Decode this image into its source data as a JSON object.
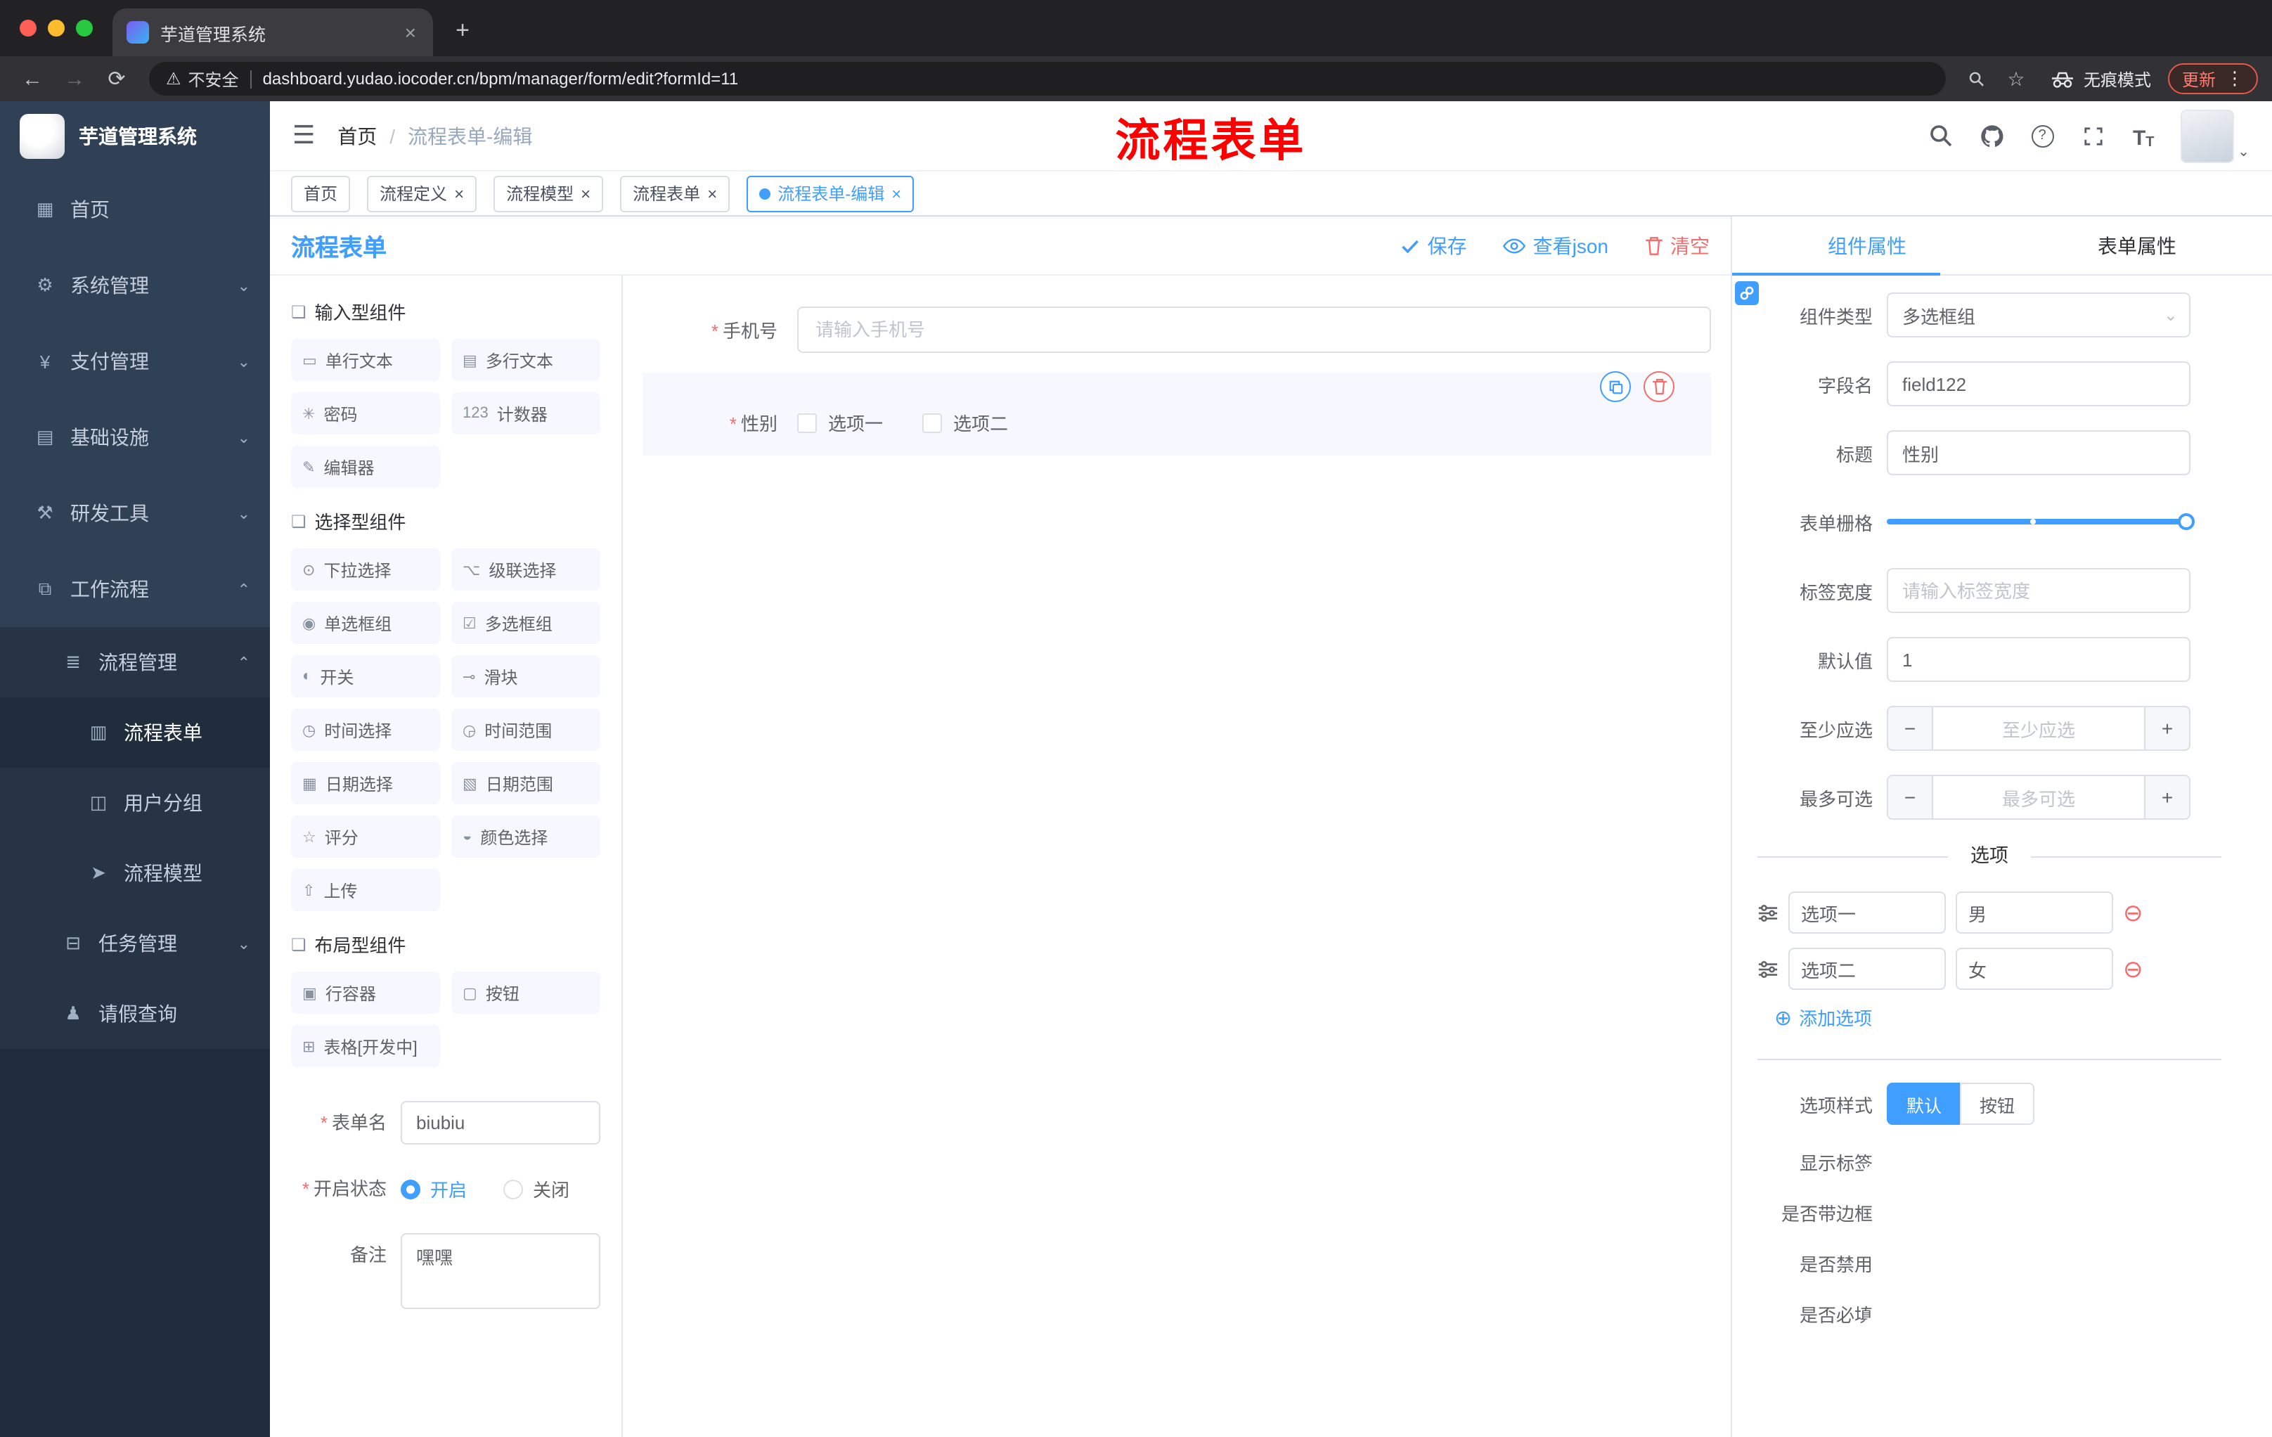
{
  "ui": {
    "required": "*",
    "close": "×",
    "slash": "/",
    "kebab": "⋮",
    "caret_down": "⌄",
    "plus": "+",
    "minus": "−",
    "add_circle": "⊕",
    "remove_circle": "⊖",
    "hamburger": "☰",
    "back": "←",
    "forward": "→",
    "reload": "⟳",
    "warning": "⚠",
    "star": "☆",
    "key": "⚲",
    "question": "?",
    "fontsize_big": "T",
    "fontsize_small": "T",
    "new_tab": "+",
    "dot": "●"
  },
  "browser": {
    "tab_title": "芋道管理系统",
    "security_label": "不安全",
    "url": "dashboard.yudao.iocoder.cn/bpm/manager/form/edit?formId=11",
    "incognito_label": "无痕模式",
    "update_label": "更新"
  },
  "sidebar": {
    "logo_title": "芋道管理系统",
    "items": [
      {
        "label": "首页",
        "icon": "home-icon",
        "glyph": "▦",
        "level_class": "lvl1"
      },
      {
        "label": "系统管理",
        "icon": "gear-icon",
        "glyph": "⚙",
        "level_class": "lvl1",
        "chevron": "⌄"
      },
      {
        "label": "支付管理",
        "icon": "payment-icon",
        "glyph": "¥",
        "level_class": "lvl1",
        "chevron": "⌄"
      },
      {
        "label": "基础设施",
        "icon": "infrastructure-icon",
        "glyph": "▤",
        "level_class": "lvl1",
        "chevron": "⌄"
      },
      {
        "label": "研发工具",
        "icon": "devtools-icon",
        "glyph": "⚒",
        "level_class": "lvl1",
        "chevron": "⌄"
      },
      {
        "label": "工作流程",
        "icon": "workflow-icon",
        "glyph": "⧉",
        "level_class": "lvl1",
        "chevron": "⌃",
        "expanded": true
      },
      {
        "label": "流程管理",
        "icon": "process-management-icon",
        "glyph": "≣",
        "level_class": "lvl2",
        "chevron": "⌃",
        "expanded": true
      },
      {
        "label": "流程表单",
        "icon": "process-form-icon",
        "glyph": "▥",
        "level_class": "lvl3",
        "active": true
      },
      {
        "label": "用户分组",
        "icon": "user-group-icon",
        "glyph": "◫",
        "level_class": "lvl3"
      },
      {
        "label": "流程模型",
        "icon": "process-model-icon",
        "glyph": "➤",
        "level_class": "lvl3"
      },
      {
        "label": "任务管理",
        "icon": "task-management-icon",
        "glyph": "⊟",
        "level_class": "lvl2",
        "chevron": "⌄"
      },
      {
        "label": "请假查询",
        "icon": "leave-query-icon",
        "glyph": "♟",
        "level_class": "lvl2"
      }
    ]
  },
  "header": {
    "breadcrumb": [
      "首页",
      "流程表单-编辑"
    ],
    "annotation": "流程表单"
  },
  "tags": [
    {
      "label": "首页"
    },
    {
      "label": "流程定义",
      "closable": true
    },
    {
      "label": "流程模型",
      "closable": true
    },
    {
      "label": "流程表单",
      "closable": true
    },
    {
      "label": "流程表单-编辑",
      "closable": true,
      "active": true
    }
  ],
  "designer": {
    "title": "流程表单",
    "actions": {
      "save": "保存",
      "view_json": "查看json",
      "clear": "清空"
    },
    "palette": {
      "sections": [
        {
          "title": "输入型组件",
          "glyph": "❏",
          "items": [
            {
              "label": "单行文本",
              "icon": "single-line-text-icon",
              "glyph": "▭"
            },
            {
              "label": "多行文本",
              "icon": "multi-line-text-icon",
              "glyph": "▤"
            },
            {
              "label": "密码",
              "icon": "password-icon",
              "glyph": "✳"
            },
            {
              "label": "计数器",
              "icon": "counter-icon",
              "glyph": "123"
            },
            {
              "label": "编辑器",
              "icon": "editor-icon",
              "glyph": "✎"
            }
          ]
        },
        {
          "title": "选择型组件",
          "glyph": "❏",
          "items": [
            {
              "label": "下拉选择",
              "icon": "dropdown-select-icon",
              "glyph": "⊙"
            },
            {
              "label": "级联选择",
              "icon": "cascade-select-icon",
              "glyph": "⌥"
            },
            {
              "label": "单选框组",
              "icon": "radio-group-icon",
              "glyph": "◉"
            },
            {
              "label": "多选框组",
              "icon": "checkbox-group-icon",
              "glyph": "☑"
            },
            {
              "label": "开关",
              "icon": "switch-icon",
              "glyph": "◐"
            },
            {
              "label": "滑块",
              "icon": "slider-icon",
              "glyph": "⊸"
            },
            {
              "label": "时间选择",
              "icon": "time-picker-icon",
              "glyph": "◷"
            },
            {
              "label": "时间范围",
              "icon": "time-range-icon",
              "glyph": "◶"
            },
            {
              "label": "日期选择",
              "icon": "date-picker-icon",
              "glyph": "▦"
            },
            {
              "label": "日期范围",
              "icon": "date-range-icon",
              "glyph": "▧"
            },
            {
              "label": "评分",
              "icon": "rate-icon",
              "glyph": "☆"
            },
            {
              "label": "颜色选择",
              "icon": "color-picker-icon",
              "glyph": "◒"
            },
            {
              "label": "上传",
              "icon": "upload-icon",
              "glyph": "⇧"
            }
          ]
        },
        {
          "title": "布局型组件",
          "glyph": "❏",
          "items": [
            {
              "label": "行容器",
              "icon": "row-container-icon",
              "glyph": "▣"
            },
            {
              "label": "按钮",
              "icon": "button-icon",
              "glyph": "▢"
            },
            {
              "label": "表格[开发中]",
              "icon": "table-icon",
              "glyph": "⊞"
            }
          ]
        }
      ],
      "form": {
        "name_label": "表单名",
        "name_value": "biubiu",
        "status_label": "开启状态",
        "status_on": "开启",
        "status_off": "关闭",
        "remark_label": "备注",
        "remark_value": "嘿嘿"
      }
    },
    "canvas": {
      "phone": {
        "label": "手机号",
        "placeholder": "请输入手机号"
      },
      "gender": {
        "label": "性别",
        "options": [
          "选项一",
          "选项二"
        ]
      }
    }
  },
  "props": {
    "tab_component": "组件属性",
    "tab_form": "表单属性",
    "component_type": {
      "label": "组件类型",
      "value": "多选框组"
    },
    "field_name": {
      "label": "字段名",
      "value": "field122"
    },
    "title": {
      "label": "标题",
      "value": "性别"
    },
    "grid": {
      "label": "表单栅格"
    },
    "label_width": {
      "label": "标签宽度",
      "placeholder": "请输入标签宽度"
    },
    "default_value": {
      "label": "默认值",
      "value": "1"
    },
    "min_select": {
      "label": "至少应选",
      "placeholder": "至少应选"
    },
    "max_select": {
      "label": "最多可选",
      "placeholder": "最多可选"
    },
    "options_title": "选项",
    "options": [
      {
        "label": "选项一",
        "value": "男"
      },
      {
        "label": "选项二",
        "value": "女"
      }
    ],
    "add_option": "添加选项",
    "style": {
      "label": "选项样式",
      "options": [
        "默认",
        "按钮"
      ],
      "selected": "默认"
    },
    "switches": [
      {
        "label": "显示标签",
        "on": true
      },
      {
        "label": "是否带边框",
        "on": false
      },
      {
        "label": "是否禁用",
        "on": false
      },
      {
        "label": "是否必填",
        "on": true
      }
    ]
  }
}
